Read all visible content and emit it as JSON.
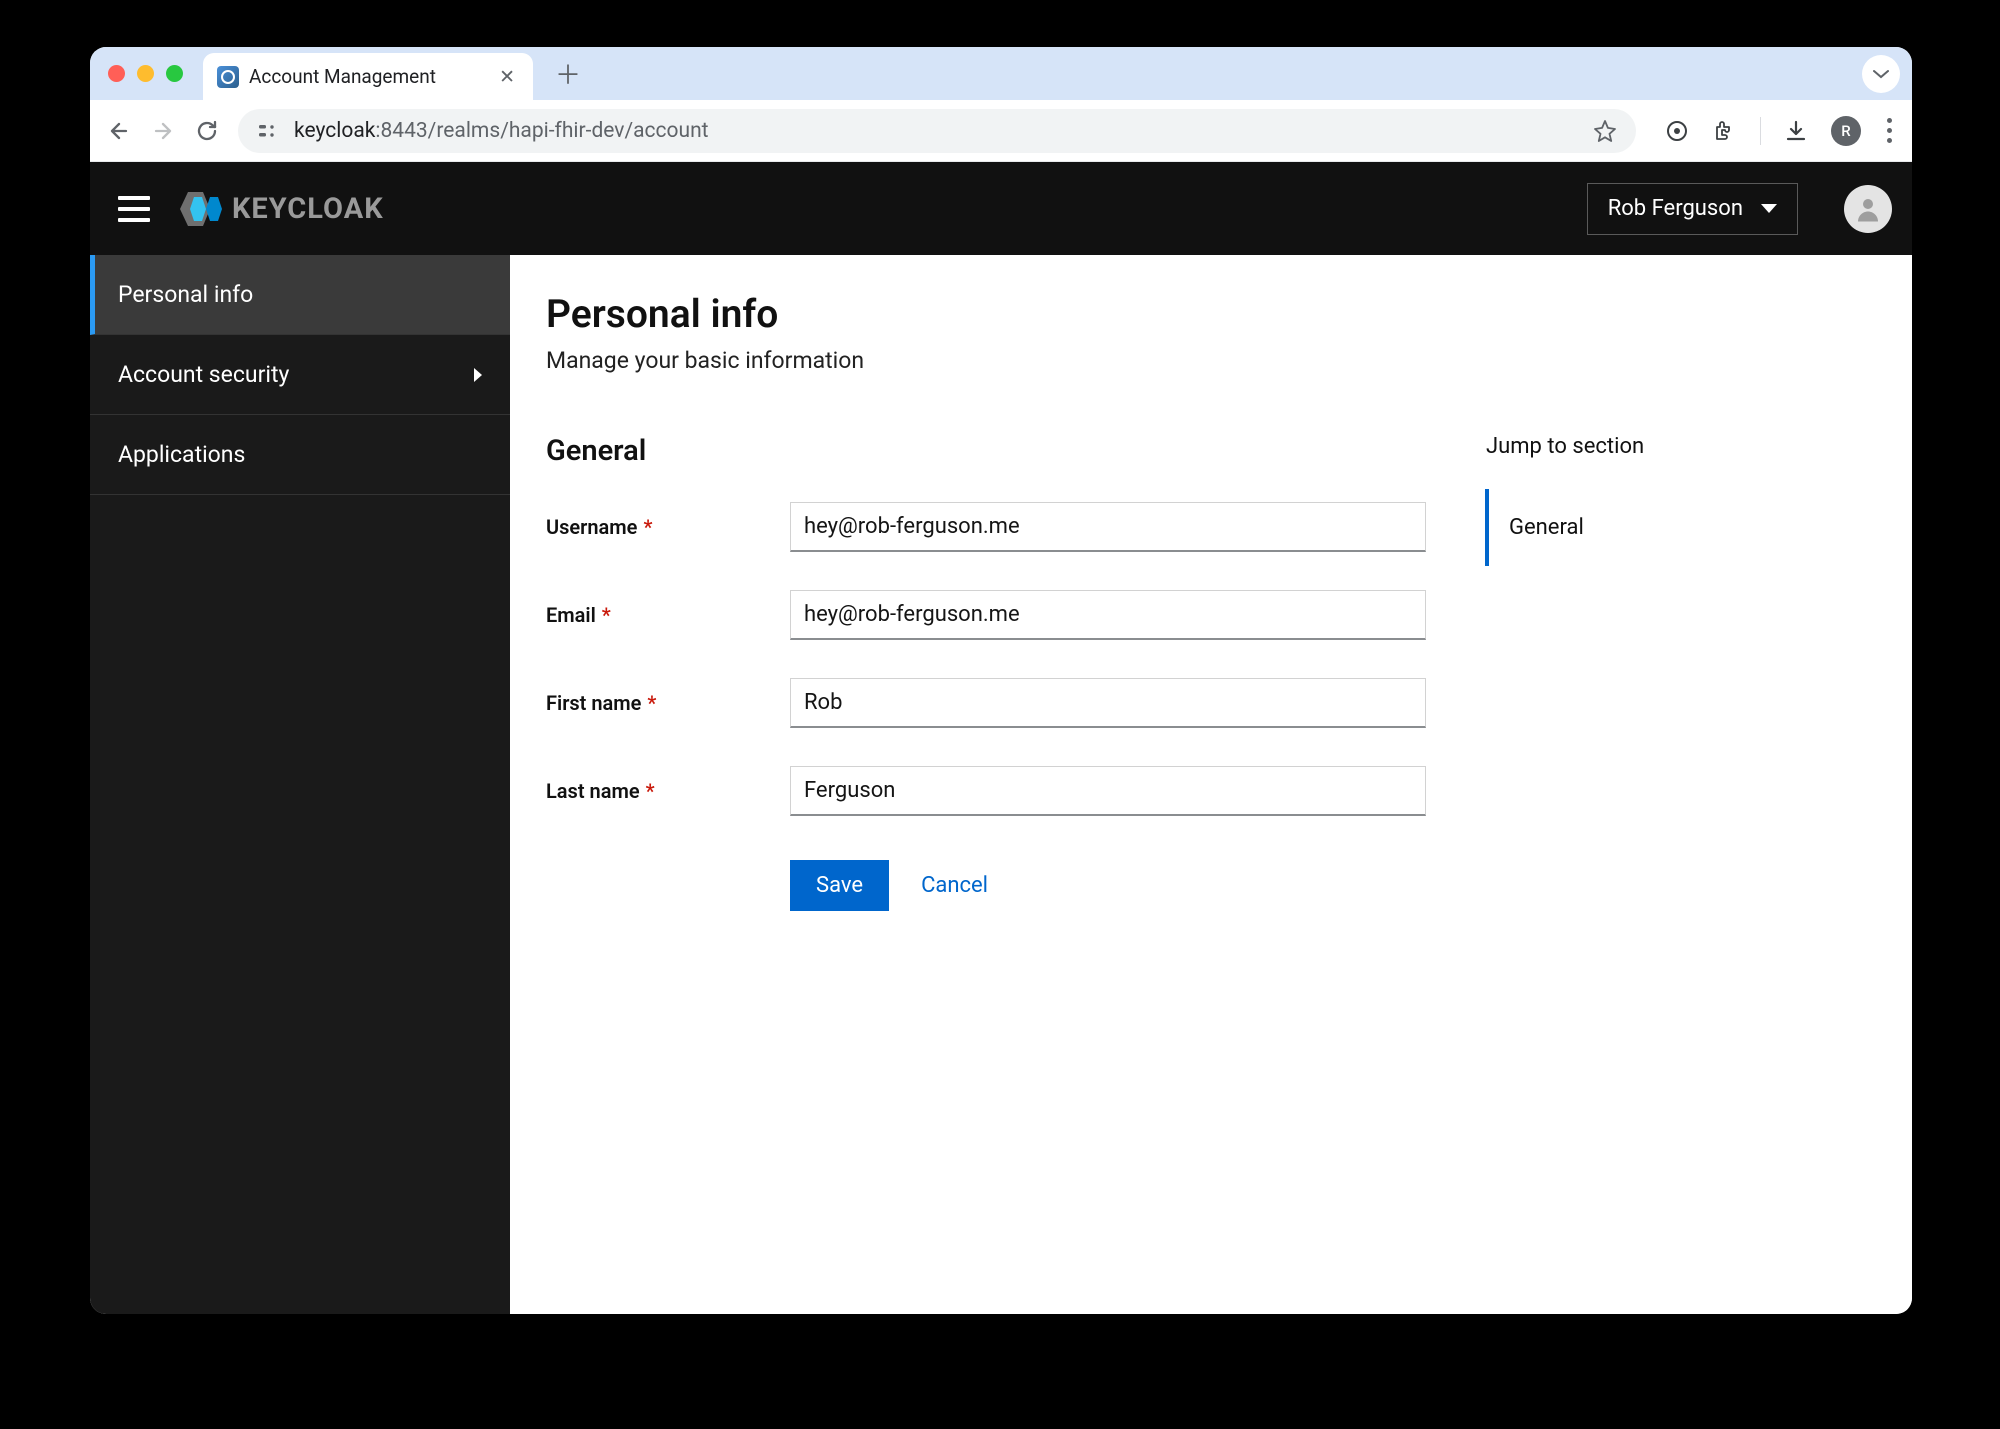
{
  "browser": {
    "tab_title": "Account Management",
    "url_host": "keycloak",
    "url_port_path": ":8443/realms/hapi-fhir-dev/account",
    "profile_initial": "R"
  },
  "header": {
    "brand": "KEYCLOAK",
    "user_display": "Rob Ferguson"
  },
  "sidebar": {
    "items": [
      {
        "label": "Personal info",
        "active": true,
        "expandable": false
      },
      {
        "label": "Account security",
        "active": false,
        "expandable": true
      },
      {
        "label": "Applications",
        "active": false,
        "expandable": false
      }
    ]
  },
  "page": {
    "title": "Personal info",
    "subtitle": "Manage your basic information",
    "section_title": "General",
    "jump_title": "Jump to section",
    "jump_items": [
      {
        "label": "General",
        "active": true
      }
    ],
    "fields": {
      "username": {
        "label": "Username",
        "value": "hey@rob-ferguson.me",
        "required": true
      },
      "email": {
        "label": "Email",
        "value": "hey@rob-ferguson.me",
        "required": true
      },
      "first_name": {
        "label": "First name",
        "value": "Rob",
        "required": true
      },
      "last_name": {
        "label": "Last name",
        "value": "Ferguson",
        "required": true
      }
    },
    "buttons": {
      "save": "Save",
      "cancel": "Cancel"
    }
  }
}
